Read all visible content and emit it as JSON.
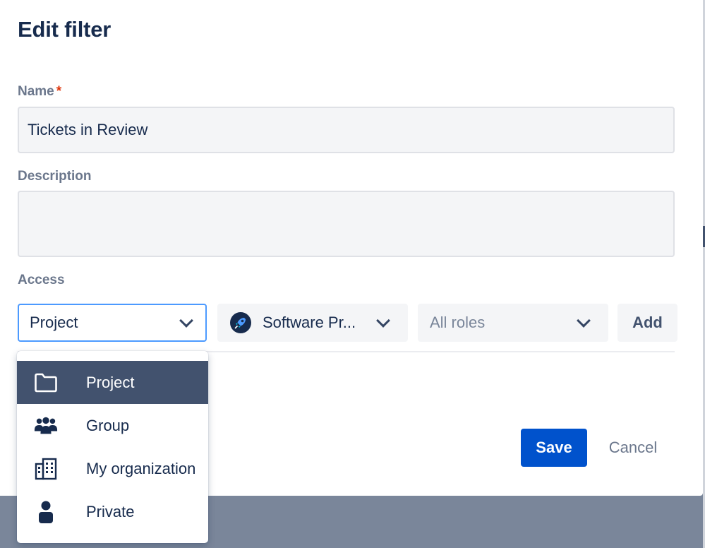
{
  "dialog": {
    "title": "Edit filter"
  },
  "name_field": {
    "label": "Name",
    "required_marker": "*",
    "value": "Tickets in Review"
  },
  "description_field": {
    "label": "Description",
    "value": ""
  },
  "access": {
    "label": "Access",
    "type_select": {
      "value": "Project",
      "icon": "chevron-down-icon"
    },
    "project_select": {
      "value": "Software Pr...",
      "icon": "rocket-icon"
    },
    "roles_select": {
      "placeholder": "All roles",
      "icon": "chevron-down-icon"
    },
    "add_label": "Add"
  },
  "dropdown": {
    "items": [
      {
        "label": "Project",
        "icon": "folder-icon",
        "selected": true
      },
      {
        "label": "Group",
        "icon": "group-icon",
        "selected": false
      },
      {
        "label": "My organization",
        "icon": "building-icon",
        "selected": false
      },
      {
        "label": "Private",
        "icon": "person-icon",
        "selected": false
      }
    ]
  },
  "footer": {
    "save_label": "Save",
    "cancel_label": "Cancel"
  },
  "colors": {
    "primary": "#0052cc",
    "selected_item_bg": "#42526e",
    "focus_border": "#4c9aff",
    "required": "#de350b",
    "overlay": "#7a869a"
  }
}
